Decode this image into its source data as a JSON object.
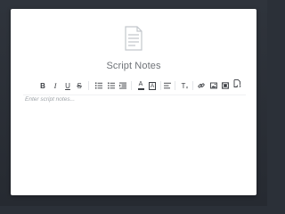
{
  "modal": {
    "title": "Script Notes",
    "header_icon": "notes-document-icon"
  },
  "toolbar": {
    "buttons": [
      {
        "name": "bold-button",
        "label": "B",
        "icon": "bold-icon"
      },
      {
        "name": "italic-button",
        "label": "I",
        "icon": "italic-icon"
      },
      {
        "name": "underline-button",
        "label": "U",
        "icon": "underline-icon"
      },
      {
        "name": "strikethrough-button",
        "label": "S",
        "icon": "strikethrough-icon"
      },
      {
        "name": "ordered-list-button",
        "icon": "ordered-list-icon"
      },
      {
        "name": "bullet-list-button",
        "icon": "bullet-list-icon"
      },
      {
        "name": "indent-button",
        "icon": "indent-icon"
      },
      {
        "name": "text-color-button",
        "label": "A",
        "icon": "text-color-icon"
      },
      {
        "name": "highlight-button",
        "label": "A",
        "icon": "highlight-icon"
      },
      {
        "name": "align-button",
        "icon": "align-left-icon"
      },
      {
        "name": "clear-format-button",
        "label": "T",
        "icon": "clear-format-icon"
      },
      {
        "name": "link-button",
        "icon": "link-icon"
      },
      {
        "name": "image-button",
        "icon": "image-icon"
      },
      {
        "name": "video-button",
        "icon": "video-icon"
      },
      {
        "name": "code-view-button",
        "icon": "code-view-icon"
      }
    ]
  },
  "editor": {
    "placeholder": "Enter script notes..."
  },
  "colors": {
    "backdrop": "#2b3038",
    "modal_bg": "#ffffff",
    "title_text": "#6f7378",
    "icon_gray": "#c3c7cc",
    "toolbar_icon": "#3a3d42",
    "placeholder_text": "#9ea3a8"
  }
}
